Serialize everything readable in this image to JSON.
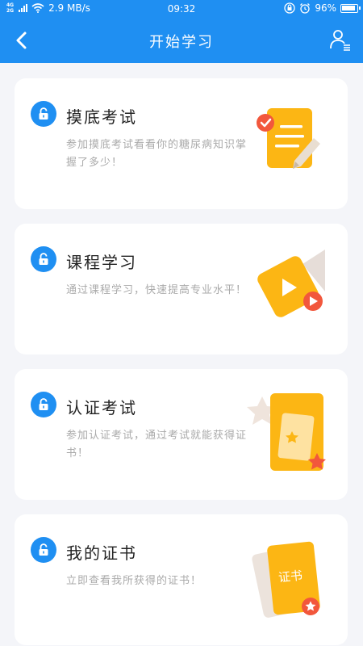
{
  "status_bar": {
    "network_top": "4G",
    "network_bottom": "2G",
    "speed": "2.9 MB/s",
    "time": "09:32",
    "battery": "96%"
  },
  "header": {
    "title": "开始学习",
    "back_icon": "chevron-left-icon",
    "user_icon": "user-list-icon"
  },
  "colors": {
    "primary": "#1f8ff2",
    "accent_yellow": "#fcb614",
    "accent_red": "#f2573c"
  },
  "cards": [
    {
      "title": "摸底考试",
      "desc": "参加摸底考试看看你的糖尿病知识掌握了多少！",
      "icon": "lock-icon"
    },
    {
      "title": "课程学习",
      "desc": "通过课程学习，快速提高专业水平！",
      "icon": "lock-icon"
    },
    {
      "title": "认证考试",
      "desc": "参加认证考试，通过考试就能获得证书！",
      "icon": "lock-icon"
    },
    {
      "title": "我的证书",
      "desc": "立即查看我所获得的证书！",
      "icon": "lock-icon",
      "badge_text": "证书"
    }
  ]
}
